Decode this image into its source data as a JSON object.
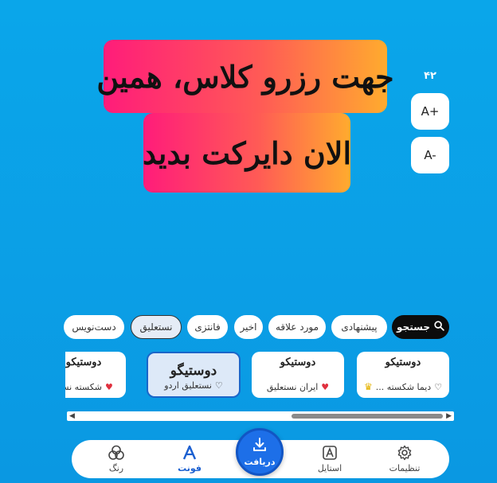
{
  "preview": {
    "line1": "جهت رزرو کلاس، همین",
    "line2": "الان دایرکت بدید"
  },
  "size": {
    "value": "۴۲",
    "increase_label": "A+",
    "decrease_label": "A-"
  },
  "chips": [
    {
      "label": "جستجو",
      "type": "search"
    },
    {
      "label": "پیشنهادی"
    },
    {
      "label": "مورد علاقه"
    },
    {
      "label": "اخیر"
    },
    {
      "label": "فانتزی"
    },
    {
      "label": "نستعلیق",
      "selected": true
    },
    {
      "label": "دست‌نویس"
    }
  ],
  "font_cards": [
    {
      "sample": "دوستیکو",
      "label": "دیما شکسته ...",
      "heart": "outline",
      "crown": true
    },
    {
      "sample": "دوستیکو",
      "label": "ایران نستعلیق",
      "heart": "red"
    },
    {
      "sample": "دوستیگو",
      "label": "نستعلیق اردو",
      "heart": "outline",
      "selected": true
    },
    {
      "sample": "دوستیکو",
      "label": "شکسته نستع",
      "heart": "red"
    }
  ],
  "nav": {
    "settings": "تنظیمات",
    "style": "استایل",
    "download": "دریافت",
    "font": "فونت",
    "color": "رنگ"
  },
  "colors": {
    "background": "#0aa6ea",
    "accent": "#1a5fd0",
    "gradient_start": "#ff1c7a",
    "gradient_end": "#ffab2e"
  }
}
